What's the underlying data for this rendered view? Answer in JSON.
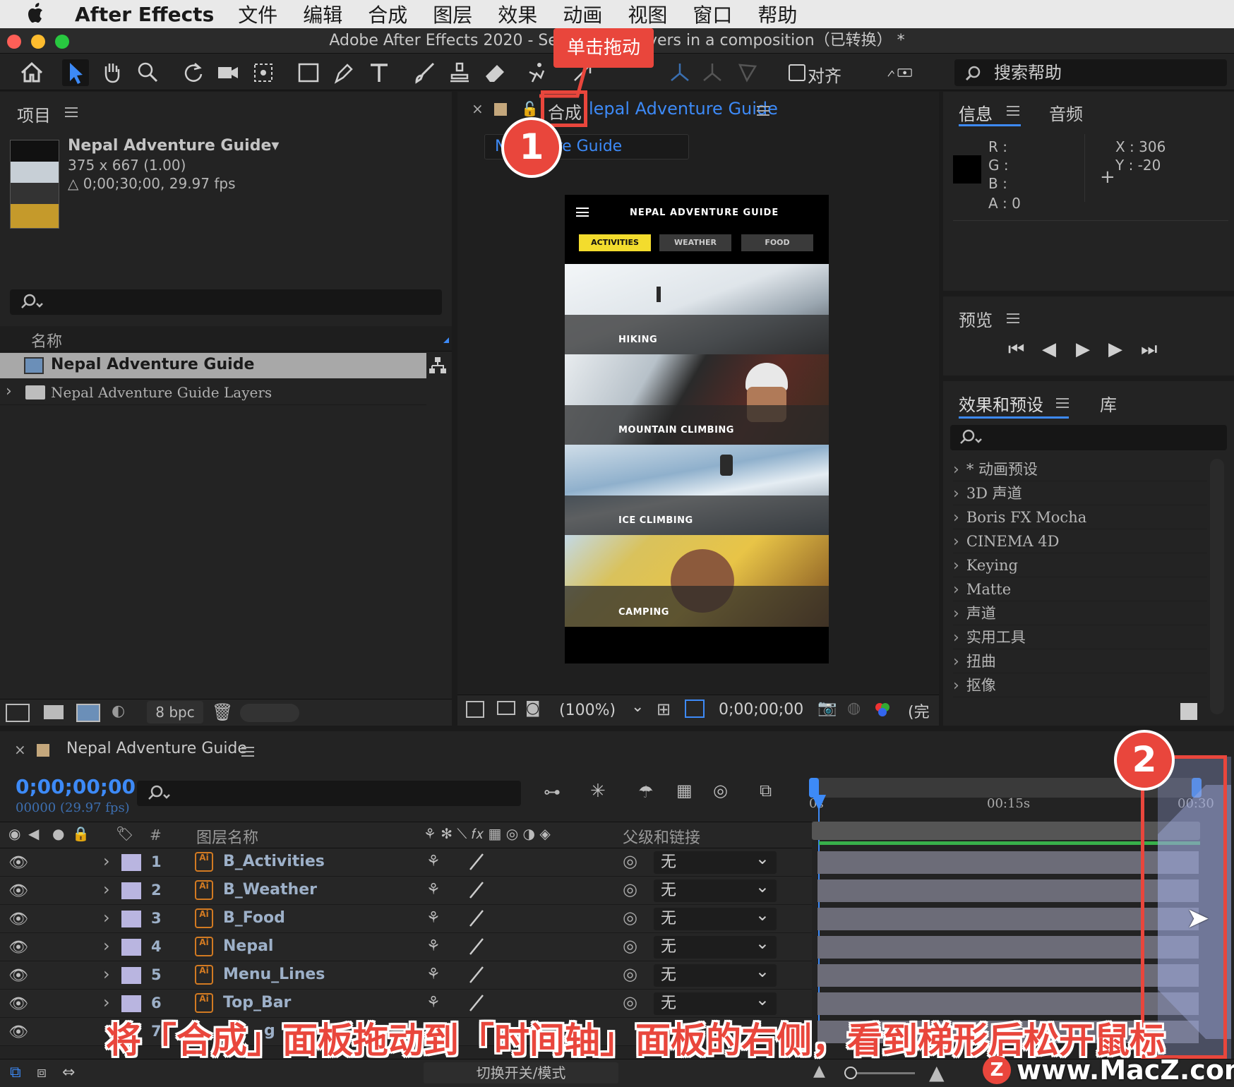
{
  "menubar": {
    "app_name": "After Effects",
    "items": [
      "文件",
      "编辑",
      "合成",
      "图层",
      "效果",
      "动画",
      "视图",
      "窗口",
      "帮助"
    ]
  },
  "window": {
    "title": "Adobe After Effects 2020 - Select a          ple layers in a composition（已转换） *"
  },
  "toolbar": {
    "snap_label": "对齐",
    "help_search_placeholder": "搜索帮助"
  },
  "callouts": {
    "drag_label": "单击拖动",
    "step1": "1",
    "step2": "2"
  },
  "project_panel": {
    "title": "项目",
    "comp_name": "Nepal Adventure Guide▾",
    "comp_size": "375 x 667 (1.00)",
    "comp_duration": "△ 0;00;30;00, 29.97 fps",
    "column_name": "名称",
    "items": [
      {
        "name": "Nepal Adventure Guide",
        "selected": true
      },
      {
        "name": "Nepal Adventure Guide Layers",
        "selected": false
      }
    ],
    "bit_depth": "8 bpc"
  },
  "comp_panel": {
    "tab_prefix": "合成",
    "tab_name": "lepal Adventure Guide",
    "sub_tab": "N           venture Guide",
    "zoom": "(100%)",
    "timecode": "0;00;00;00",
    "quality": "(完"
  },
  "phone": {
    "header_title": "NEPAL ADVENTURE GUIDE",
    "tabs": [
      {
        "label": "ACTIVITIES",
        "active": true
      },
      {
        "label": "WEATHER",
        "active": false
      },
      {
        "label": "FOOD",
        "active": false
      }
    ],
    "cards": [
      "HIKING",
      "MOUNTAIN CLIMBING",
      "ICE CLIMBING",
      "CAMPING"
    ]
  },
  "info_panel": {
    "tabs": [
      "信息",
      "音频"
    ],
    "r": "R :",
    "g": "G :",
    "b": "B :",
    "a": "A :  0",
    "x": "X : 306",
    "y": "Y :  -20"
  },
  "preview_panel": {
    "title": "预览"
  },
  "effects_panel": {
    "tabs": [
      "效果和预设",
      "库"
    ],
    "items": [
      "* 动画预设",
      "3D 声道",
      "Boris FX Mocha",
      "CINEMA 4D",
      "Keying",
      "Matte",
      "声道",
      "实用工具",
      "扭曲",
      "抠像"
    ]
  },
  "timeline": {
    "comp_name": "Nepal Adventure Guide",
    "timecode": "0;00;00;00",
    "frame_info": "00000 (29.97 fps)",
    "col_num": "#",
    "col_layer_name": "图层名称",
    "col_parent": "父级和链接",
    "ruler": [
      "0s",
      "00:15s",
      "00:30"
    ],
    "layers": [
      {
        "num": "1",
        "name": "B_Activities",
        "parent": "无"
      },
      {
        "num": "2",
        "name": "B_Weather",
        "parent": "无"
      },
      {
        "num": "3",
        "name": "B_Food",
        "parent": "无"
      },
      {
        "num": "4",
        "name": "Nepal",
        "parent": "无"
      },
      {
        "num": "5",
        "name": "Menu_Lines",
        "parent": "无"
      },
      {
        "num": "6",
        "name": "Top_Bar",
        "parent": "无"
      },
      {
        "num": "7",
        "name": "g",
        "parent": ""
      }
    ],
    "toggle_label": "切换开关/模式"
  },
  "caption": "将「合成」面板拖动到「时间轴」面板的右侧，看到梯形后松开鼠标",
  "watermark": "www.MacZ.com",
  "colors": {
    "accent_blue": "#3d8af7",
    "callout_red": "#e9463c",
    "phone_tab_active": "#f3dc2d"
  }
}
